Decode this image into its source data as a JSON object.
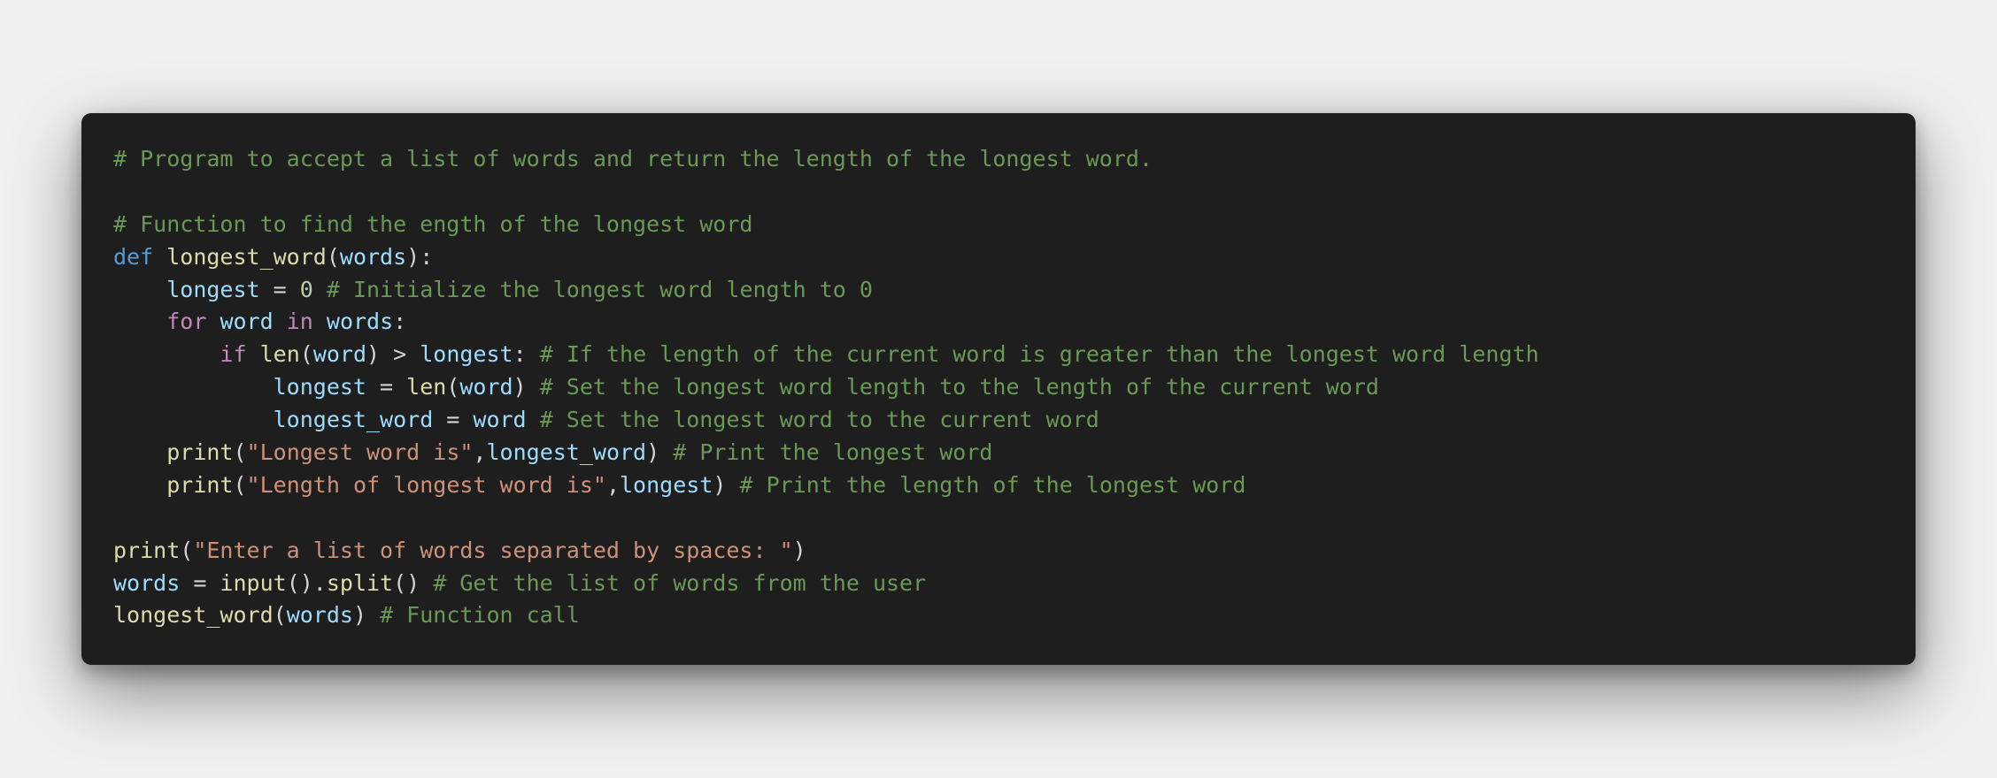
{
  "colors": {
    "page_background": "#f0f0f0",
    "editor_background": "#1e1e1e",
    "comment": "#6a9955",
    "keyword": "#569cd6",
    "control_keyword": "#c586c0",
    "function": "#dcdcaa",
    "variable": "#9cdcfe",
    "number": "#b5cea8",
    "string": "#ce9178",
    "plain": "#d4d4d4"
  },
  "code": {
    "language": "python",
    "lines": [
      [
        {
          "t": "comment",
          "v": "# Program to accept a list of words and return the length of the longest word."
        }
      ],
      [],
      [
        {
          "t": "comment",
          "v": "# Function to find the ength of the longest word"
        }
      ],
      [
        {
          "t": "keyword",
          "v": "def"
        },
        {
          "t": "plain",
          "v": " "
        },
        {
          "t": "func",
          "v": "longest_word"
        },
        {
          "t": "plain",
          "v": "("
        },
        {
          "t": "var",
          "v": "words"
        },
        {
          "t": "plain",
          "v": "):"
        }
      ],
      [
        {
          "t": "plain",
          "v": "    "
        },
        {
          "t": "var",
          "v": "longest"
        },
        {
          "t": "plain",
          "v": " = "
        },
        {
          "t": "number",
          "v": "0"
        },
        {
          "t": "plain",
          "v": " "
        },
        {
          "t": "comment",
          "v": "# Initialize the longest word length to 0"
        }
      ],
      [
        {
          "t": "plain",
          "v": "    "
        },
        {
          "t": "control",
          "v": "for"
        },
        {
          "t": "plain",
          "v": " "
        },
        {
          "t": "var",
          "v": "word"
        },
        {
          "t": "plain",
          "v": " "
        },
        {
          "t": "control",
          "v": "in"
        },
        {
          "t": "plain",
          "v": " "
        },
        {
          "t": "var",
          "v": "words"
        },
        {
          "t": "plain",
          "v": ":"
        }
      ],
      [
        {
          "t": "plain",
          "v": "        "
        },
        {
          "t": "control",
          "v": "if"
        },
        {
          "t": "plain",
          "v": " "
        },
        {
          "t": "func",
          "v": "len"
        },
        {
          "t": "plain",
          "v": "("
        },
        {
          "t": "var",
          "v": "word"
        },
        {
          "t": "plain",
          "v": ") > "
        },
        {
          "t": "var",
          "v": "longest"
        },
        {
          "t": "plain",
          "v": ": "
        },
        {
          "t": "comment",
          "v": "# If the length of the current word is greater than the longest word length"
        }
      ],
      [
        {
          "t": "plain",
          "v": "            "
        },
        {
          "t": "var",
          "v": "longest"
        },
        {
          "t": "plain",
          "v": " = "
        },
        {
          "t": "func",
          "v": "len"
        },
        {
          "t": "plain",
          "v": "("
        },
        {
          "t": "var",
          "v": "word"
        },
        {
          "t": "plain",
          "v": ") "
        },
        {
          "t": "comment",
          "v": "# Set the longest word length to the length of the current word"
        }
      ],
      [
        {
          "t": "plain",
          "v": "            "
        },
        {
          "t": "var",
          "v": "longest_word"
        },
        {
          "t": "plain",
          "v": " = "
        },
        {
          "t": "var",
          "v": "word"
        },
        {
          "t": "plain",
          "v": " "
        },
        {
          "t": "comment",
          "v": "# Set the longest word to the current word"
        }
      ],
      [
        {
          "t": "plain",
          "v": "    "
        },
        {
          "t": "func",
          "v": "print"
        },
        {
          "t": "plain",
          "v": "("
        },
        {
          "t": "string",
          "v": "\"Longest word is\""
        },
        {
          "t": "plain",
          "v": ","
        },
        {
          "t": "var",
          "v": "longest_word"
        },
        {
          "t": "plain",
          "v": ") "
        },
        {
          "t": "comment",
          "v": "# Print the longest word"
        }
      ],
      [
        {
          "t": "plain",
          "v": "    "
        },
        {
          "t": "func",
          "v": "print"
        },
        {
          "t": "plain",
          "v": "("
        },
        {
          "t": "string",
          "v": "\"Length of longest word is\""
        },
        {
          "t": "plain",
          "v": ","
        },
        {
          "t": "var",
          "v": "longest"
        },
        {
          "t": "plain",
          "v": ") "
        },
        {
          "t": "comment",
          "v": "# Print the length of the longest word"
        }
      ],
      [],
      [
        {
          "t": "func",
          "v": "print"
        },
        {
          "t": "plain",
          "v": "("
        },
        {
          "t": "string",
          "v": "\"Enter a list of words separated by spaces: \""
        },
        {
          "t": "plain",
          "v": ")"
        }
      ],
      [
        {
          "t": "var",
          "v": "words"
        },
        {
          "t": "plain",
          "v": " = "
        },
        {
          "t": "func",
          "v": "input"
        },
        {
          "t": "plain",
          "v": "()."
        },
        {
          "t": "func",
          "v": "split"
        },
        {
          "t": "plain",
          "v": "() "
        },
        {
          "t": "comment",
          "v": "# Get the list of words from the user"
        }
      ],
      [
        {
          "t": "func",
          "v": "longest_word"
        },
        {
          "t": "plain",
          "v": "("
        },
        {
          "t": "var",
          "v": "words"
        },
        {
          "t": "plain",
          "v": ") "
        },
        {
          "t": "comment",
          "v": "# Function call"
        }
      ]
    ]
  }
}
